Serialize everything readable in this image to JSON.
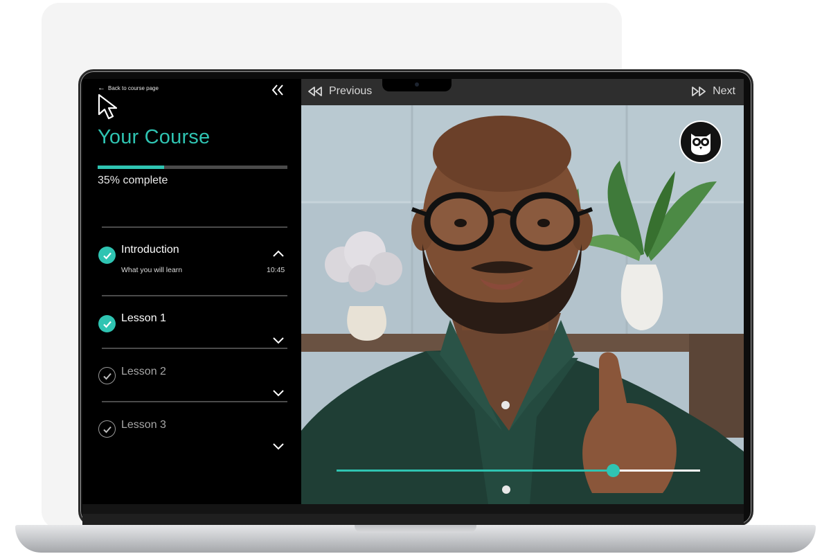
{
  "sidebar": {
    "back_label": "Back to course page",
    "title": "Your Course",
    "progress_fraction": 0.35,
    "progress_text": "35% complete",
    "lessons": [
      {
        "title": "Introduction",
        "subtitle": "What you will learn",
        "duration": "10:45",
        "completed": true,
        "expanded": true
      },
      {
        "title": "Lesson 1",
        "completed": true,
        "expanded": false
      },
      {
        "title": "Lesson 2",
        "completed": false,
        "expanded": false
      },
      {
        "title": "Lesson 3",
        "completed": false,
        "expanded": false
      }
    ]
  },
  "player": {
    "previous_label": "Previous",
    "next_label": "Next",
    "playback_fraction": 0.76,
    "badge_icon": "owl-logo-icon"
  },
  "colors": {
    "accent": "#2fc4b2",
    "sidebar_bg": "#000000",
    "topbar_bg": "#2e2e2e",
    "inactive_text": "#a7a7a7"
  }
}
